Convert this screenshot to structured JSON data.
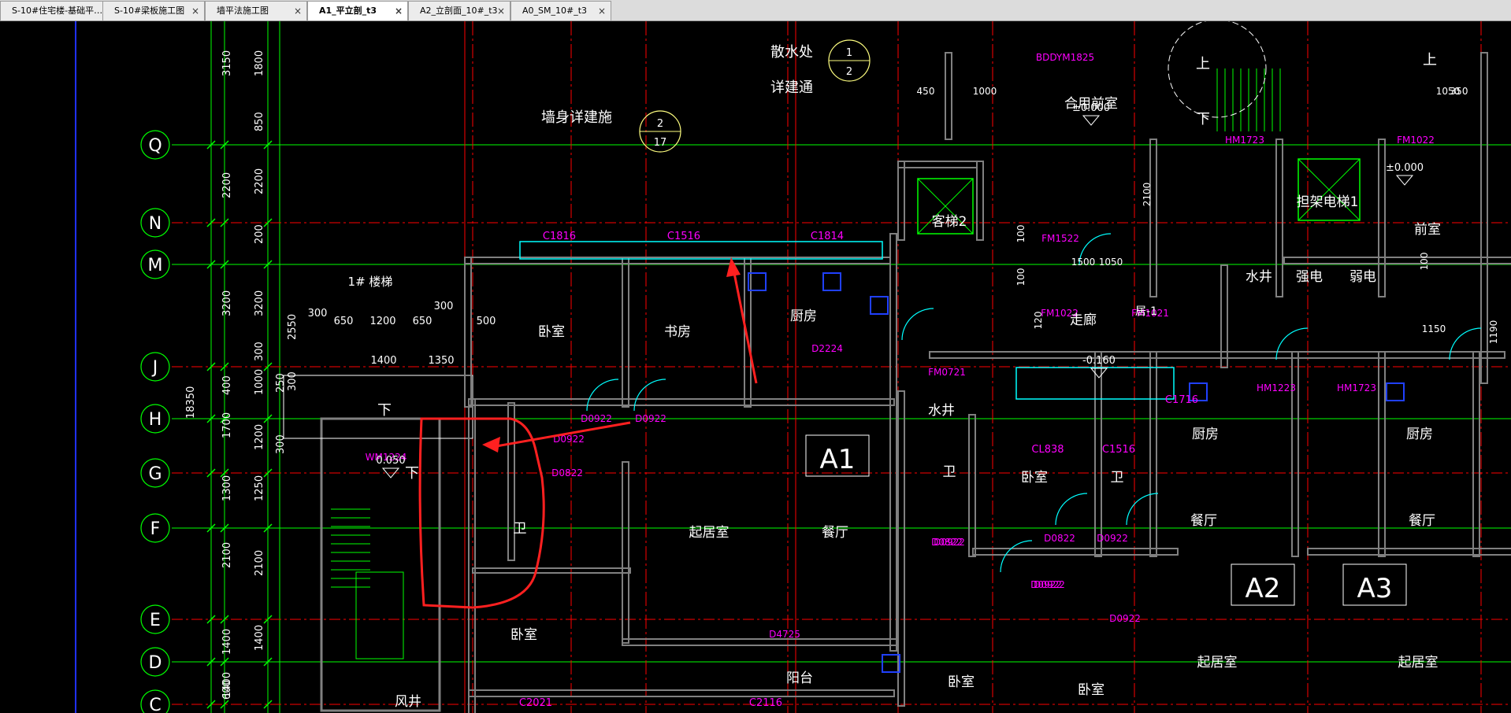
{
  "tabs": [
    {
      "label": "S-10#住宅楼-基础平…",
      "active": false
    },
    {
      "label": "S-10#梁板施工图",
      "active": false
    },
    {
      "label": "墙平法施工图",
      "active": false
    },
    {
      "label": "A1_平立剖_t3",
      "active": true
    },
    {
      "label": "A2_立剖面_10#_t3",
      "active": false
    },
    {
      "label": "A0_SM_10#_t3",
      "active": false
    }
  ],
  "close_glyph": "×",
  "axes": [
    {
      "label": "Q"
    },
    {
      "label": "N"
    },
    {
      "label": "M"
    },
    {
      "label": "J"
    },
    {
      "label": "H"
    },
    {
      "label": "G"
    },
    {
      "label": "F"
    },
    {
      "label": "E"
    },
    {
      "label": "D"
    },
    {
      "label": "C"
    }
  ],
  "dims_outer": [
    "3150",
    "2200",
    "3200",
    "400",
    "1700",
    "1300",
    "2100",
    "1400",
    "600"
  ],
  "dims_inner": [
    "1800",
    "850",
    "2200",
    "200",
    "200",
    "3200",
    "300",
    "1000",
    "250",
    "1200",
    "1250",
    "2100",
    "1400",
    "1400"
  ],
  "dim_total": "18350",
  "stair_label": "1# 楼梯",
  "stair_dims": [
    "300",
    "650",
    "1200",
    "650",
    "300",
    "500",
    "1400",
    "1350",
    "2550",
    "300",
    "300"
  ],
  "window_labels": [
    "C1816",
    "C1516",
    "C1814",
    "C2116",
    "CL838",
    "C1516",
    "C1716",
    "C2021"
  ],
  "door_labels": [
    "D0922",
    "D0922",
    "D0922",
    "D0822",
    "D0922",
    "D0822",
    "D0922",
    "D0922",
    "D0922",
    "D0922",
    "D0822",
    "D4725",
    "D2224",
    "WM1224",
    "BDDYM1825",
    "FM1522",
    "FM0721",
    "HM1223",
    "HM1723",
    "HM1723",
    "FM1022",
    "FM1022",
    "FM1021"
  ],
  "rooms": [
    "卧室",
    "书房",
    "厨房",
    "卧室",
    "卫",
    "起居室",
    "餐厅",
    "阳台",
    "客梯2",
    "走廊",
    "合用前室",
    "水井",
    "强电",
    "弱电",
    "担架电梯1",
    "前室",
    "水井",
    "卫",
    "卧室",
    "卫",
    "厨房",
    "餐厅",
    "起居室",
    "卧室",
    "卧室",
    "厨房",
    "餐厅",
    "起居室",
    "风井"
  ],
  "unit_tags": [
    "A1",
    "A2",
    "A3"
  ],
  "notes": [
    "散水处",
    "详建通",
    "墙身详建施",
    "居-1"
  ],
  "levels": [
    "0.050",
    "±0.000",
    "±0.000",
    "-0.160"
  ],
  "misc_dims": [
    "450",
    "1000",
    "1500",
    "1050",
    "100",
    "100",
    "120",
    "2100",
    "350",
    "1050",
    "100",
    "1150",
    "1190"
  ],
  "detail_refs": [
    {
      "top": "1",
      "bottom": "2"
    },
    {
      "top": "2",
      "bottom": "17"
    }
  ],
  "stair_arrows": [
    "下",
    "上",
    "下",
    "上",
    "下"
  ],
  "colors": {
    "bg": "#000000",
    "grid": "#00ff00",
    "axis_line": "#ff0000",
    "wall": "#808080",
    "window": "#00ffff",
    "label": "#ff00ff",
    "text": "#ffffff",
    "markup": "#ff2020",
    "fixture": "#2040ff"
  }
}
